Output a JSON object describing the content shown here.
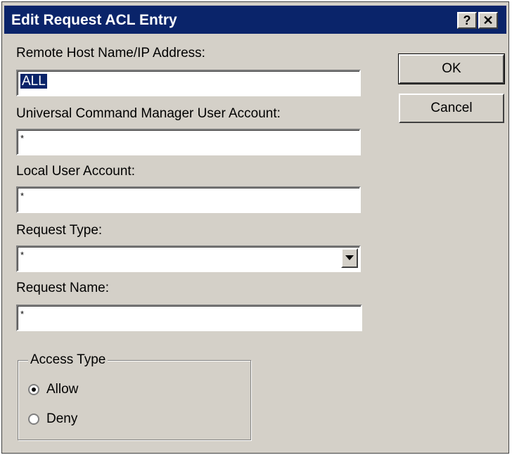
{
  "dialog": {
    "title": "Edit Request ACL Entry",
    "help_label": "?",
    "close_label": "✕"
  },
  "fields": {
    "remote_host": {
      "label": "Remote Host Name/IP Address:",
      "value": "ALL"
    },
    "ucm_user": {
      "label": "Universal Command Manager User Account:",
      "value": "*"
    },
    "local_user": {
      "label": "Local User Account:",
      "value": "*"
    },
    "request_type": {
      "label": "Request Type:",
      "value": "*"
    },
    "request_name": {
      "label": "Request Name:",
      "value": "*"
    }
  },
  "buttons": {
    "ok": "OK",
    "cancel": "Cancel"
  },
  "access_type": {
    "legend": "Access Type",
    "options": [
      {
        "label": "Allow",
        "selected": true
      },
      {
        "label": "Deny",
        "selected": false
      }
    ]
  },
  "colors": {
    "titlebar": "#0a246a",
    "face": "#d4d0c8"
  },
  "icons": {
    "dropdown": "chevron-down-icon",
    "help": "help-icon",
    "close": "close-icon"
  }
}
